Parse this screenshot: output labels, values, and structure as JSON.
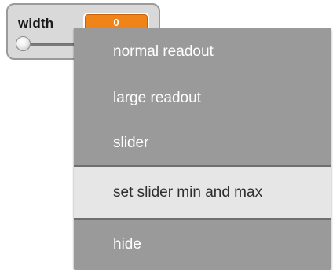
{
  "watcher": {
    "label": "width",
    "value": "0",
    "style": "slider",
    "slider_fraction": 0.0
  },
  "context_menu": {
    "items": [
      {
        "label": "normal readout",
        "highlighted": false
      },
      {
        "label": "large readout",
        "highlighted": false
      },
      {
        "label": "slider",
        "highlighted": false
      },
      {
        "label": "set slider min and max",
        "highlighted": true
      },
      {
        "label": "hide",
        "highlighted": false
      }
    ]
  },
  "colors": {
    "menu_background": "#9a9a9a",
    "menu_highlight": "#e6e6e6",
    "menu_text": "#ffffff",
    "value_badge": "#f08418",
    "watcher_background": "#d9d9d9"
  }
}
